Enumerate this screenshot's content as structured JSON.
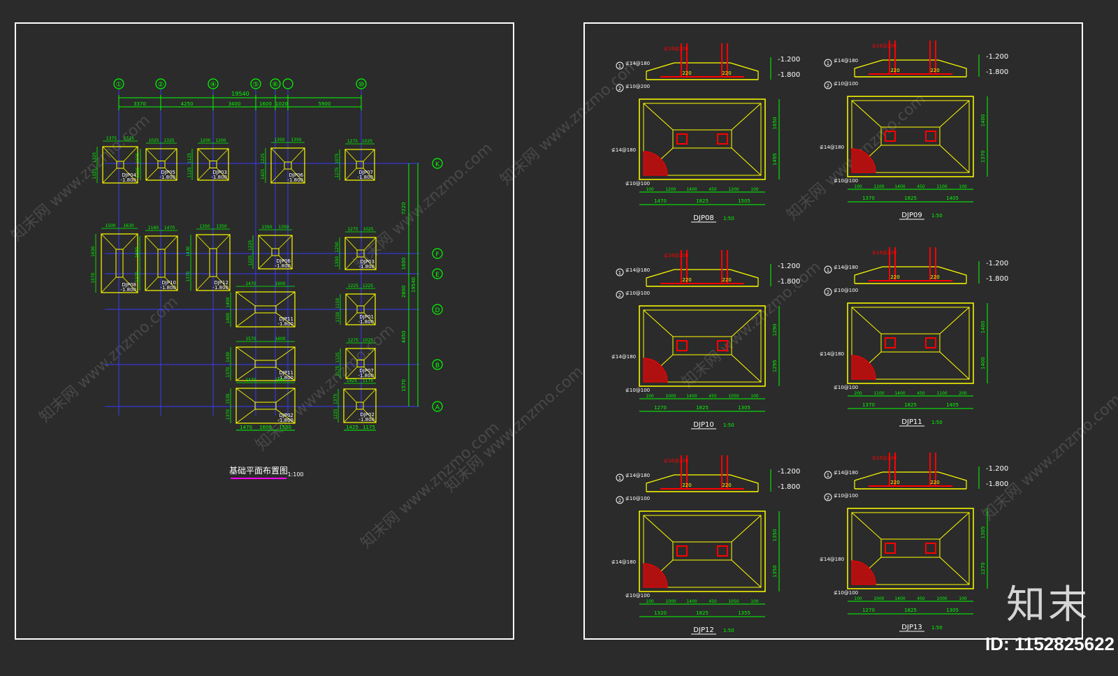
{
  "plan": {
    "title": "基础平面布置图",
    "scale": "1:100",
    "total_width": "19540",
    "total_depth": "19540",
    "col_dims": [
      "3370",
      "4250",
      "3400",
      "1600",
      "1020",
      "5900"
    ],
    "row_dims": [
      "7220",
      "1600",
      "2800",
      "4450",
      "1570"
    ],
    "grid_cols": [
      "①",
      "②",
      "④",
      "⑤",
      "⑥",
      "",
      "⑩"
    ],
    "grid_rows": [
      "K",
      "F",
      "E",
      "D",
      "B",
      "A"
    ],
    "footings": [
      {
        "tag": "DJP04",
        "elev": "-1.800",
        "w1": "1375",
        "w2": "1525",
        "h1": "1325",
        "h2": "1325"
      },
      {
        "tag": "DJP05",
        "elev": "-1.800",
        "w1": "1025",
        "w2": "1325",
        "h1": "1075",
        "h2": "1325"
      },
      {
        "tag": "DJP03",
        "elev": "-1.800",
        "w1": "1200",
        "w2": "1200",
        "h1": "1125",
        "h2": "1125"
      },
      {
        "tag": "DJP06",
        "elev": "-1.800",
        "w1": "1350",
        "w2": "1350",
        "h1": "1225",
        "h2": "1425"
      },
      {
        "tag": "DJP07",
        "elev": "-1.800",
        "w1": "1275",
        "w2": "1025",
        "h1": "1075",
        "h2": "1275"
      },
      {
        "tag": "DJP08",
        "elev": "-1.800",
        "w1": "1500",
        "w2": "1630",
        "h1": "1630",
        "h2": "1570"
      },
      {
        "tag": "DJP10",
        "elev": "-1.800",
        "w1": "1160",
        "w2": "1470",
        "h1": "1600",
        "h2": "1270"
      },
      {
        "tag": "DJP12",
        "elev": "-1.800",
        "w1": "1350",
        "w2": "1350",
        "h1": "1430",
        "h2": "1370"
      },
      {
        "tag": "DJP06",
        "elev": "-1.800",
        "w1": "1350",
        "w2": "1350",
        "h1": "1225",
        "h2": "1225"
      },
      {
        "tag": "DJP03",
        "elev": "-1.800",
        "w1": "1275",
        "w2": "1025",
        "h1": "1250",
        "h2": "1350"
      },
      {
        "tag": "DJP11",
        "elev": "-1.800",
        "w1": "1470",
        "w2": "1600",
        "h1": "1400",
        "h2": "1400"
      },
      {
        "tag": "DJP01",
        "elev": "-1.800",
        "w1": "1225",
        "w2": "1225",
        "h1": "1150",
        "h2": "1150"
      },
      {
        "tag": "DJP11",
        "elev": "-1.800",
        "w1": "1570",
        "w2": "1600",
        "h1": "1430",
        "h2": "1370"
      },
      {
        "tag": "DJP07",
        "elev": "-1.800",
        "w1": "1275",
        "w2": "1025",
        "h1": "1125",
        "h2": "1175"
      },
      {
        "tag": "DJP02",
        "elev": "-1.800",
        "w1": "1470",
        "w2": "1600",
        "h1": "1530",
        "h2": "1370"
      },
      {
        "tag": "DJP02",
        "elev": "-1.800",
        "w1": "1425",
        "w2": "1175",
        "h1": "1375",
        "h2": "1225"
      }
    ],
    "bottom_dims_a": [
      "1470",
      "1600",
      "1530"
    ],
    "bottom_dims_b": [
      "1425",
      "1175"
    ]
  },
  "details": [
    {
      "tag": "DJP08",
      "scale": "1:50",
      "top_rebar": "⊈16@200",
      "side_rebar": "⊈14@180",
      "base_rebar": "⊈10@200",
      "mesh_a": "⊈14@180",
      "mesh_b": "⊈10@100",
      "elev_top": "-1.200",
      "elev_bot": "-1.800",
      "spacing": "220",
      "dims_top": [
        "100",
        "1200",
        "1400",
        "450",
        "1200",
        "100"
      ],
      "dims_bot": [
        "1470",
        "1825",
        "1505"
      ],
      "dims_v": [
        "1650",
        "1495"
      ]
    },
    {
      "tag": "DJP09",
      "scale": "1:50",
      "top_rebar": "⊈16@200",
      "side_rebar": "⊈14@180",
      "base_rebar": "⊈10@100",
      "mesh_a": "⊈14@180",
      "mesh_b": "⊈10@100",
      "elev_top": "-1.200",
      "elev_bot": "-1.800",
      "spacing": "220",
      "dims_top": [
        "100",
        "1100",
        "1400",
        "450",
        "1100",
        "100"
      ],
      "dims_bot": [
        "1370",
        "1825",
        "1405"
      ],
      "dims_v": [
        "1400",
        "1370"
      ]
    },
    {
      "tag": "DJP10",
      "scale": "1:50",
      "top_rebar": "⊈16@200",
      "side_rebar": "⊈14@180",
      "base_rebar": "⊈10@100",
      "mesh_a": "⊈14@180",
      "mesh_b": "⊈10@100",
      "elev_top": "-1.200",
      "elev_bot": "-1.800",
      "spacing": "220",
      "dims_top": [
        "100",
        "1000",
        "1400",
        "450",
        "1050",
        "100"
      ],
      "dims_bot": [
        "1270",
        "1825",
        "1305"
      ],
      "dims_v": [
        "1290",
        "1295"
      ]
    },
    {
      "tag": "DJP11",
      "scale": "1:50",
      "top_rebar": "⊈16@200",
      "side_rebar": "⊈14@180",
      "base_rebar": "⊈10@100",
      "mesh_a": "⊈14@180",
      "mesh_b": "⊈10@100",
      "elev_top": "-1.200",
      "elev_bot": "-1.800",
      "spacing": "220",
      "dims_top": [
        "200",
        "1100",
        "1400",
        "450",
        "1100",
        "200"
      ],
      "dims_bot": [
        "1370",
        "1825",
        "1405"
      ],
      "dims_v": [
        "1400",
        "1400"
      ]
    },
    {
      "tag": "DJP12",
      "scale": "1:50",
      "top_rebar": "⊈16@200",
      "side_rebar": "⊈14@180",
      "base_rebar": "⊈10@100",
      "mesh_a": "⊈14@180",
      "mesh_b": "⊈10@100",
      "elev_top": "-1.200",
      "elev_bot": "-1.800",
      "spacing": "220",
      "dims_top": [
        "100",
        "1000",
        "1400",
        "450",
        "1050",
        "100"
      ],
      "dims_bot": [
        "1320",
        "1825",
        "1355"
      ],
      "dims_v": [
        "1350",
        "1350"
      ]
    },
    {
      "tag": "DJP13",
      "scale": "1:50",
      "top_rebar": "⊈16@200",
      "side_rebar": "⊈14@180",
      "base_rebar": "⊈10@100",
      "mesh_a": "⊈14@180",
      "mesh_b": "⊈10@100",
      "elev_top": "-1.200",
      "elev_bot": "-1.800",
      "spacing": "220",
      "dims_top": [
        "100",
        "1000",
        "1400",
        "450",
        "1000",
        "100"
      ],
      "dims_bot": [
        "1270",
        "1825",
        "1305"
      ],
      "dims_v": [
        "1305",
        "1270"
      ]
    }
  ],
  "watermark": {
    "text_cn": "知末网",
    "text_url": "www.znzmo.com"
  },
  "brand": {
    "logo": "知末",
    "id_label": "ID: 1152825622"
  },
  "colors": {
    "background": "#2b2b2b",
    "frame": "#ffffff",
    "dim": "#00ff00",
    "outline": "#ffff00",
    "axis": "#3a3aff",
    "rebar": "#ff0000",
    "title_underline": "#ff00ff",
    "label": "#ffffff"
  }
}
